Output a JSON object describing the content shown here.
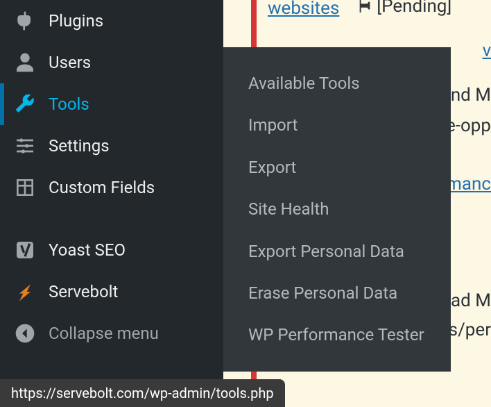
{
  "sidebar": {
    "items": [
      {
        "label": "Plugins",
        "icon": "plug-icon"
      },
      {
        "label": "Users",
        "icon": "user-icon"
      },
      {
        "label": "Tools",
        "icon": "wrench-icon"
      },
      {
        "label": "Settings",
        "icon": "sliders-icon"
      },
      {
        "label": "Custom Fields",
        "icon": "grid-icon"
      },
      {
        "label": "Yoast SEO",
        "icon": "yoast-icon"
      },
      {
        "label": "Servebolt",
        "icon": "servebolt-icon"
      },
      {
        "label": "Collapse menu",
        "icon": "collapse-icon"
      }
    ]
  },
  "submenu": {
    "items": [
      {
        "label": "Available Tools"
      },
      {
        "label": "Import"
      },
      {
        "label": "Export"
      },
      {
        "label": "Site Health"
      },
      {
        "label": "Export Personal Data"
      },
      {
        "label": "Erase Personal Data"
      },
      {
        "label": "WP Performance Tester"
      }
    ]
  },
  "content": {
    "link_websites": "websites",
    "pending": "[Pending]",
    "link_vis": "vis",
    "frag1a": "nd M",
    "frag1b": "e-opp",
    "link_mance": "manc",
    "frag2a": "ad M",
    "frag2b": "s/per",
    "ellipsis": "[...]"
  },
  "status_bar": {
    "url": "https://servebolt.com/wp-admin/tools.php"
  }
}
